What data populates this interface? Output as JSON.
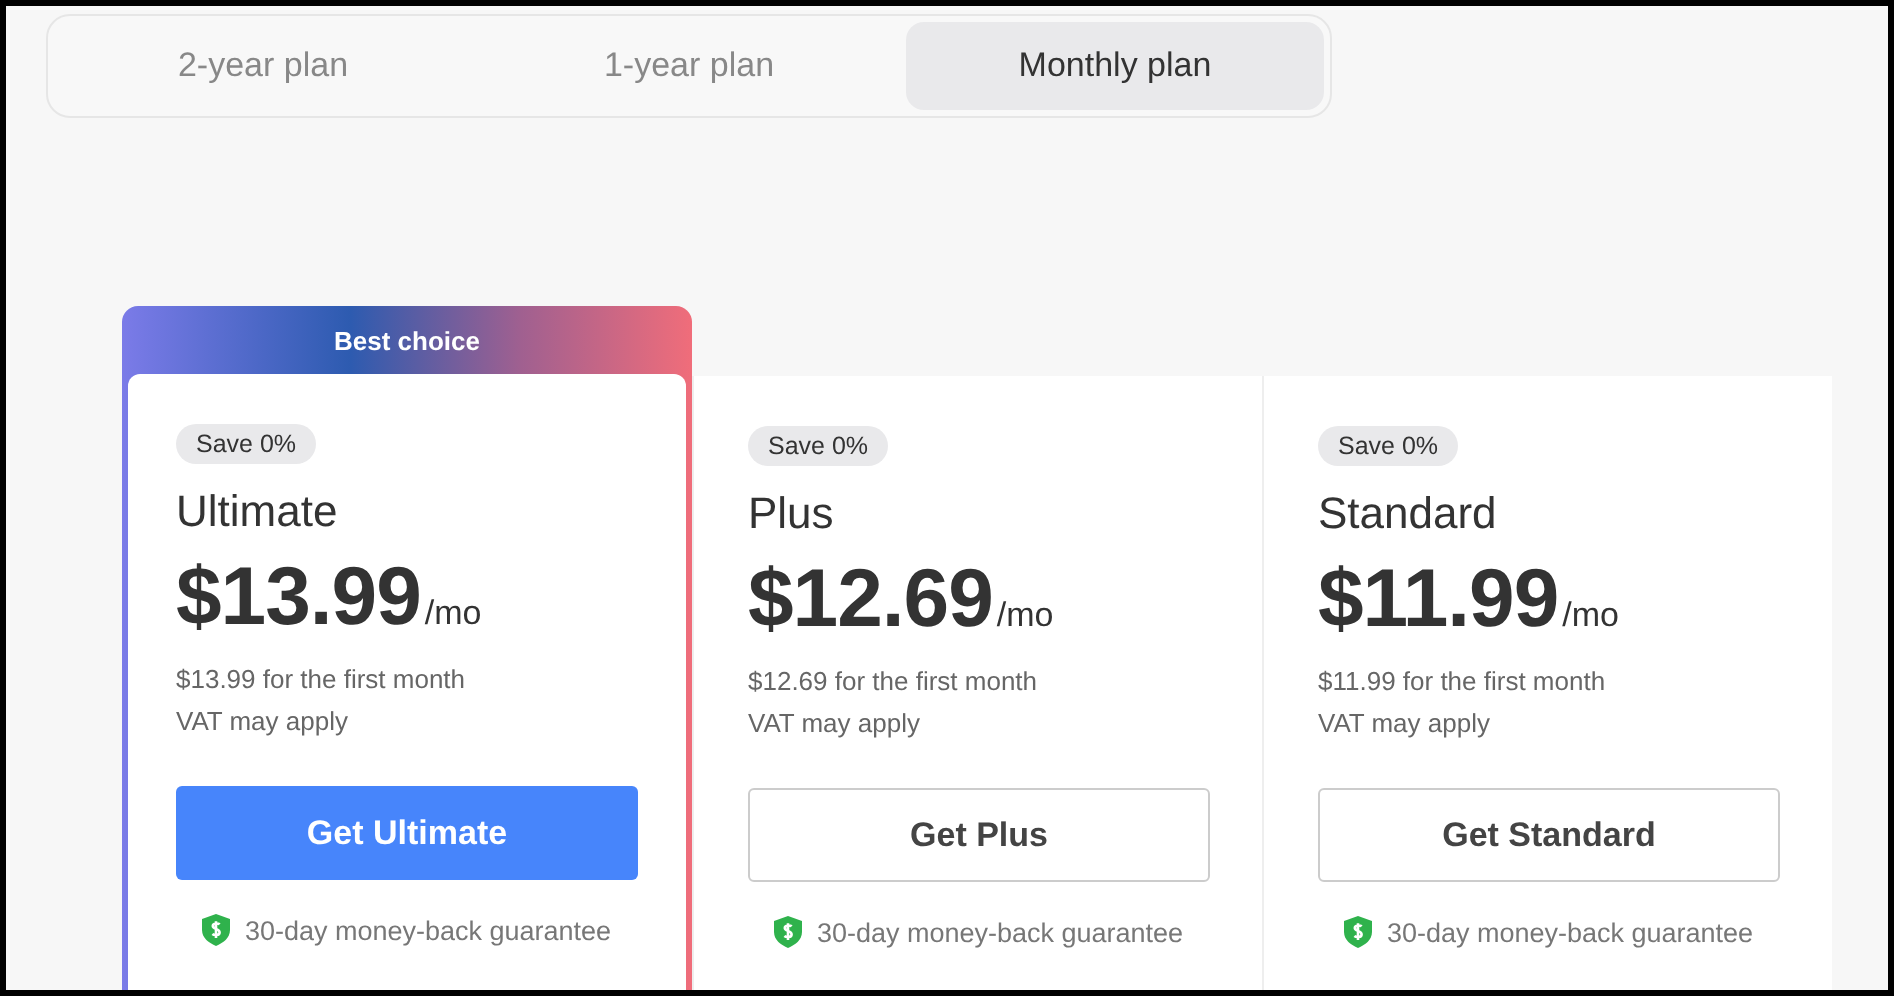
{
  "tabs": [
    {
      "label": "2-year plan",
      "selected": false
    },
    {
      "label": "1-year plan",
      "selected": false
    },
    {
      "label": "Monthly plan",
      "selected": true
    }
  ],
  "plans": [
    {
      "featured": true,
      "banner": "Best choice",
      "badge": "Save 0%",
      "name": "Ultimate",
      "price": "$13.99",
      "unit": "/mo",
      "first_month": "$13.99 for the first month",
      "vat": "VAT may apply",
      "button": "Get Ultimate",
      "guarantee": "30-day money-back guarantee"
    },
    {
      "featured": false,
      "badge": "Save 0%",
      "name": "Plus",
      "price": "$12.69",
      "unit": "/mo",
      "first_month": "$12.69 for the first month",
      "vat": "VAT may apply",
      "button": "Get Plus",
      "guarantee": "30-day money-back guarantee"
    },
    {
      "featured": false,
      "badge": "Save 0%",
      "name": "Standard",
      "price": "$11.99",
      "unit": "/mo",
      "first_month": "$11.99 for the first month",
      "vat": "VAT may apply",
      "button": "Get Standard",
      "guarantee": "30-day money-back guarantee"
    }
  ]
}
